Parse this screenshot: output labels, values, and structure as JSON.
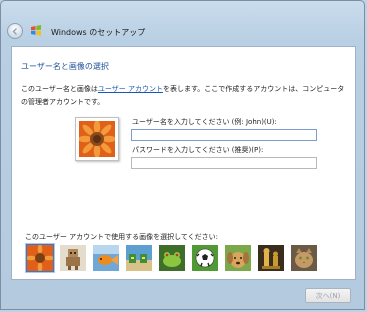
{
  "window": {
    "title": "Windows のセットアップ"
  },
  "page": {
    "heading": "ユーザー名と画像の選択",
    "desc_part1": "このユーザー名と画像は",
    "desc_link": "ユーザー アカウント",
    "desc_part2": "を表します。ここで作成するアカウントは、コンピュータの管理者アカウントです。"
  },
  "form": {
    "username_label": "ユーザー名を入力してください (例: John)(U):",
    "username_value": "",
    "password_label": "パスワードを入力してください (推奨)(P):",
    "password_value": ""
  },
  "pictures": {
    "label": "このユーザー アカウントで使用する画像を選択してください:",
    "items": [
      {
        "name": "flower",
        "selected": true
      },
      {
        "name": "robot",
        "selected": false
      },
      {
        "name": "goldfish",
        "selected": false
      },
      {
        "name": "beach-chairs",
        "selected": false
      },
      {
        "name": "frog",
        "selected": false
      },
      {
        "name": "soccer-ball",
        "selected": false
      },
      {
        "name": "puppy",
        "selected": false
      },
      {
        "name": "chess-pieces",
        "selected": false
      },
      {
        "name": "cat",
        "selected": false
      }
    ]
  },
  "footer": {
    "next_label": "次へ(N)"
  },
  "colors": {
    "heading": "#1e4f99",
    "link": "#1a57b5",
    "selection": "#3b79c6"
  }
}
